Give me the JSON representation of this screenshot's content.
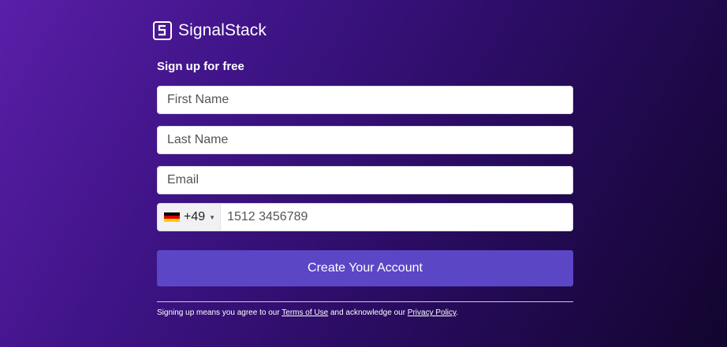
{
  "brand": {
    "name_light": "Signal",
    "name_bold": "Stack",
    "icon": "signalstack-logo-icon"
  },
  "form": {
    "heading": "Sign up for free",
    "first_name_placeholder": "First Name",
    "last_name_placeholder": "Last Name",
    "email_placeholder": "Email",
    "phone": {
      "country_flag": "germany-flag-icon",
      "dial_code": "+49",
      "placeholder": "1512 3456789"
    },
    "submit_label": "Create Your Account"
  },
  "legal": {
    "prefix": "Signing up means you agree to our ",
    "terms_link": "Terms of Use",
    "middle": " and acknowledge our ",
    "privacy_link": "Privacy Policy",
    "suffix": "."
  },
  "colors": {
    "background_start": "#5a1ea8",
    "background_end": "#12052e",
    "button": "#5b46c6"
  }
}
